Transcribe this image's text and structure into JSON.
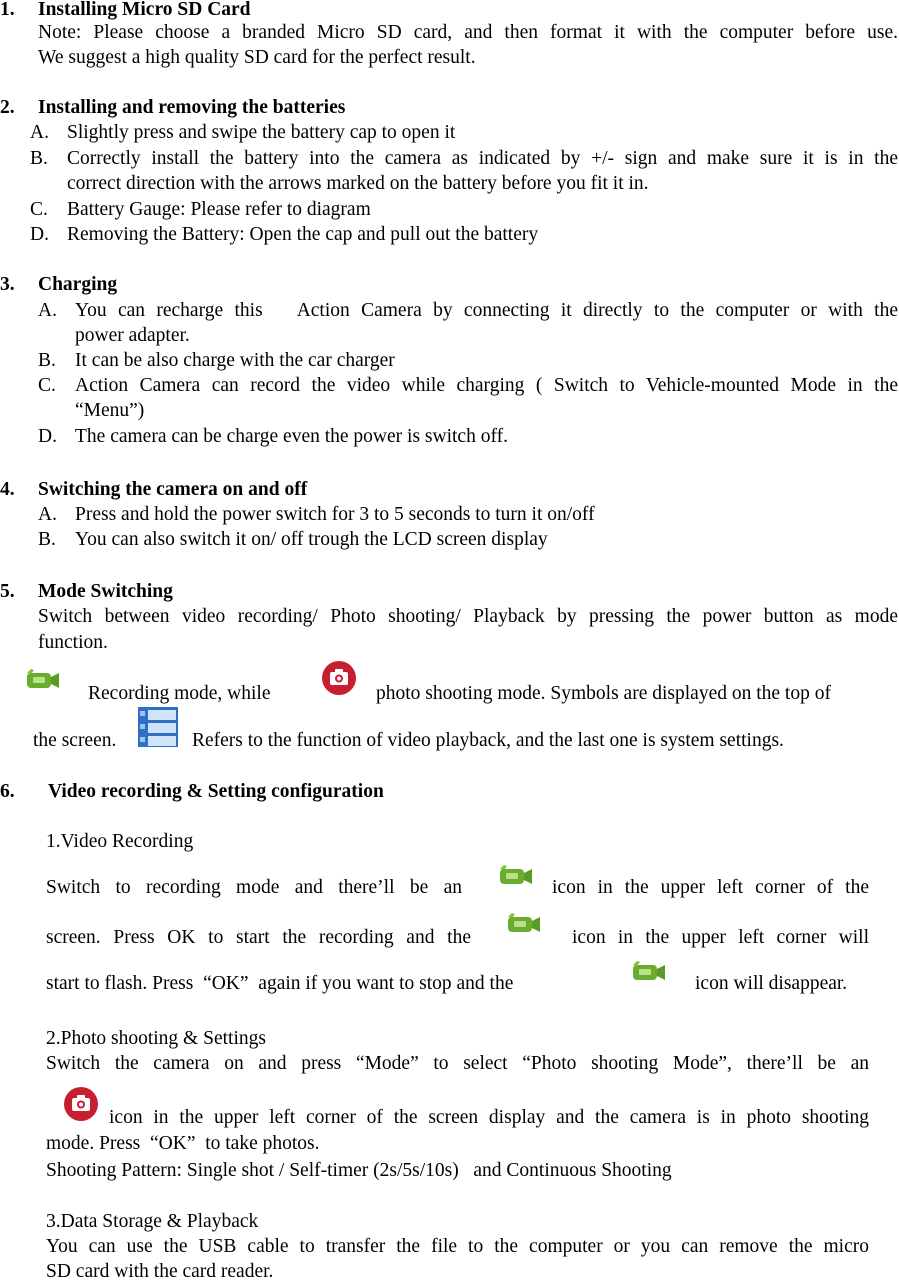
{
  "sections": {
    "s1": {
      "num": "1.",
      "title": "Installing Micro SD Card",
      "lines": [
        "Note: Please choose a branded Micro SD card, and then format it with the computer before use.",
        "We suggest a high quality SD card for the perfect result."
      ]
    },
    "s2": {
      "num": "2.",
      "title": "Installing and removing the batteries",
      "items": [
        {
          "marker": "A.",
          "lines": [
            "Slightly press and swipe the battery cap to open it"
          ]
        },
        {
          "marker": "B.",
          "lines": [
            "Correctly install the battery into the camera as indicated by +/- sign and make sure it is in the",
            "correct direction with the arrows marked on the battery before you fit it in."
          ]
        },
        {
          "marker": "C.",
          "lines": [
            "Battery Gauge: Please refer to diagram"
          ]
        },
        {
          "marker": "D.",
          "lines": [
            "Removing the Battery: Open the cap and pull out the battery"
          ]
        }
      ]
    },
    "s3": {
      "num": "3.",
      "title": "Charging",
      "items": [
        {
          "marker": "A.",
          "lines": [
            "You can recharge this   Action Camera by connecting it directly to the computer or with the",
            "power adapter."
          ]
        },
        {
          "marker": "B.",
          "lines": [
            "It can be also charge with the car charger"
          ]
        },
        {
          "marker": "C.",
          "lines": [
            "Action Camera can record the video while charging ( Switch to Vehicle-mounted Mode in the",
            "“Menu”)"
          ]
        },
        {
          "marker": "D.",
          "lines": [
            "The camera can be charge even the power is switch off."
          ]
        }
      ]
    },
    "s4": {
      "num": "4.",
      "title": "Switching the camera on and off",
      "items": [
        {
          "marker": "A.",
          "lines": [
            "Press and hold the power switch for 3 to 5 seconds to turn it on/off"
          ]
        },
        {
          "marker": "B.",
          "lines": [
            "You can also switch it on/ off trough the LCD screen display"
          ]
        }
      ]
    },
    "s5": {
      "num": "5.",
      "title": "Mode Switching",
      "lines": [
        "Switch between video recording/ Photo shooting/ Playback by pressing the power button as mode",
        "function."
      ],
      "icon_line1_a": "Recording mode, while",
      "icon_line1_b": "photo shooting mode. Symbols are displayed on the top of",
      "icon_line2_a": "the screen.",
      "icon_line2_b": "Refers to the function of video playback, and the last one is system settings."
    },
    "s6": {
      "num": "6.",
      "title": "Video recording & Setting configuration",
      "sub1": {
        "title": "1.Video Recording",
        "l1a": "Switch to recording mode and there’ll be an",
        "l1b": "icon in the upper left corner of the",
        "l2a": "screen. Press OK to start the recording and the",
        "l2b": "icon in the upper left corner will",
        "l3a": "start to flash. Press  “OK”  again if you want to stop and the",
        "l3b": "icon will disappear."
      },
      "sub2": {
        "title": "2.Photo shooting & Settings",
        "l1": "Switch the camera on and press “Mode” to select “Photo shooting Mode”, there’ll be an",
        "l2": "icon in the upper left corner of the screen display and the camera is in photo shooting",
        "l3": "mode. Press  “OK”  to take photos.",
        "l4": "Shooting Pattern: Single shot / Self-timer (2s/5s/10s)   and Continuous Shooting"
      },
      "sub3": {
        "title": "3.Data Storage & Playback",
        "l1": "You can use the USB cable to transfer the file to the computer or you can remove the micro",
        "l2": "SD card with the card reader."
      }
    }
  },
  "icons": {
    "recording": "video-camera-icon",
    "photo": "photo-camera-icon",
    "playback": "playback-icon"
  },
  "colors": {
    "green": "#6aad2e",
    "red": "#c81e32",
    "blue": "#2f6fc4"
  }
}
